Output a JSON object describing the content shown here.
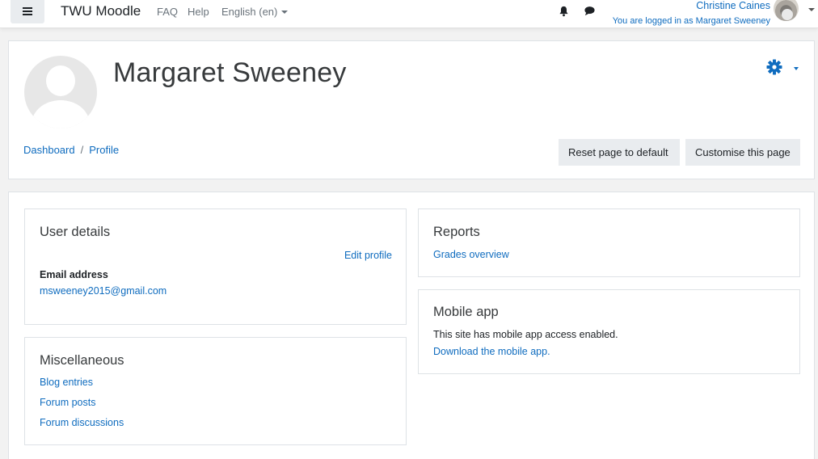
{
  "navbar": {
    "brand": "TWU Moodle",
    "links": {
      "faq": "FAQ",
      "help": "Help",
      "language": "English (en)"
    },
    "user_name": "Christine Caines",
    "logged_in_as": "You are logged in as Margaret Sweeney"
  },
  "header": {
    "profile_name": "Margaret Sweeney",
    "breadcrumb": [
      "Dashboard",
      "Profile"
    ],
    "buttons": {
      "reset": "Reset page to default",
      "customise": "Customise this page"
    }
  },
  "user_details": {
    "title": "User details",
    "edit_profile": "Edit profile",
    "email_label": "Email address",
    "email_value": "msweeney2015@gmail.com"
  },
  "miscellaneous": {
    "title": "Miscellaneous",
    "links": [
      "Blog entries",
      "Forum posts",
      "Forum discussions"
    ]
  },
  "reports": {
    "title": "Reports",
    "links": [
      "Grades overview"
    ]
  },
  "mobile_app": {
    "title": "Mobile app",
    "text": "This site has mobile app access enabled.",
    "link": "Download the mobile app."
  },
  "icons": {
    "menu": "hamburger-menu-icon",
    "notifications": "bell-icon",
    "messages": "chat-icon",
    "settings": "gear-icon"
  },
  "colors": {
    "link": "#0f6cbf",
    "text": "#373a3c",
    "page_bg": "#f2f2f2"
  }
}
